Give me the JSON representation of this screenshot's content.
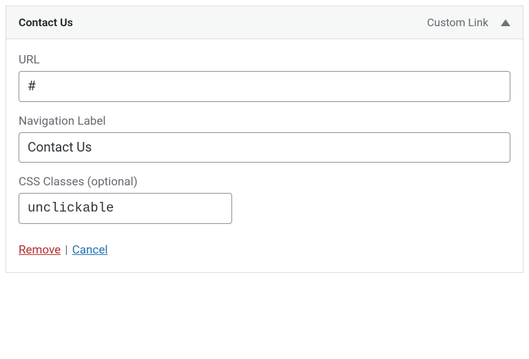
{
  "header": {
    "title": "Contact Us",
    "type": "Custom Link"
  },
  "fields": {
    "url": {
      "label": "URL",
      "value": "#"
    },
    "nav_label": {
      "label": "Navigation Label",
      "value": "Contact Us"
    },
    "css_classes": {
      "label": "CSS Classes (optional)",
      "value": "unclickable"
    }
  },
  "actions": {
    "remove": "Remove",
    "separator": " | ",
    "cancel": "Cancel"
  }
}
